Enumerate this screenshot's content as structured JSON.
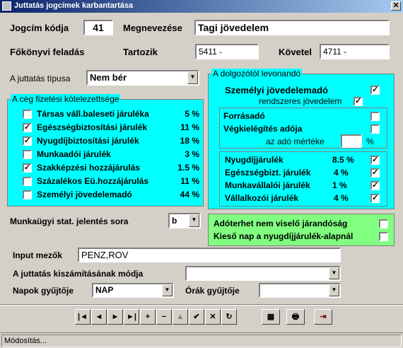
{
  "window": {
    "title": "Juttatás jogcímek karbantartása",
    "close_label": "✕"
  },
  "header": {
    "jogcim_label": "Jogcím kódja",
    "jogcim_value": "41",
    "megnevezes_label": "Megnevezése",
    "megnevezes_value": "Tagi jövedelem",
    "fokonyvi_label": "Főkönyvi feladás",
    "tartozik_label": "Tartozik",
    "tartozik_value": "5411 -",
    "kovetel_label": "Követel",
    "kovetel_value": "4711 -"
  },
  "tipus": {
    "label": "A juttatás típusa",
    "value": "Nem bér"
  },
  "ceg": {
    "title": "A cég fizetési kötelezettsége",
    "items": [
      {
        "label": "Társas váll.baleseti járuléka",
        "pct": "5 %",
        "checked": false
      },
      {
        "label": "Egészségbiztosítási járulék",
        "pct": "11 %",
        "checked": true
      },
      {
        "label": "Nyugdíjbiztosítási járulék",
        "pct": "18 %",
        "checked": true
      },
      {
        "label": "Munkaadói járulék",
        "pct": "3 %",
        "checked": false
      },
      {
        "label": "Szakképzési hozzájárulás",
        "pct": "1.5 %",
        "checked": true
      },
      {
        "label": "Százalékos Eü.hozzájárulás",
        "pct": "11 %",
        "checked": false
      },
      {
        "label": "Személyi jövedelemadó",
        "pct": "44 %",
        "checked": false
      }
    ]
  },
  "levonando": {
    "title": "A dolgozótól levonandó",
    "szja_label": "Személyi jövedelemadó",
    "szja_checked": true,
    "rendszeres_label": "rendszeres jövedelem",
    "rendszeres_checked": true,
    "forrasado_label": "Forrásadó",
    "forrasado_checked": false,
    "vegkielegites_label": "Végkielégítés adója",
    "vegkielegites_checked": false,
    "ado_mertek_label": "az adó mértéke",
    "ado_mertek_value": "",
    "ado_mertek_unit": "%",
    "items": [
      {
        "label": "Nyugdíjjárulék",
        "pct": "8.5 %",
        "checked": true
      },
      {
        "label": "Egészségbizt. járulék",
        "pct": "4 %",
        "checked": true
      },
      {
        "label": "Munkavállalói járulék",
        "pct": "1 %",
        "checked": true
      },
      {
        "label": "Vállalkozói járulék",
        "pct": "4 %",
        "checked": true
      }
    ]
  },
  "green": {
    "adoterhet_label": "Adóterhet nem viselő járandóság",
    "adoterhet_checked": false,
    "kieso_label": "Kieső nap a nyugdíjjárulék-alapnál",
    "kieso_checked": false
  },
  "munkaugyi": {
    "label": "Munkaügyi stat. jelentés sora",
    "value": "b"
  },
  "input_mezok": {
    "label": "Input mezők",
    "value": "PENZ,ROV"
  },
  "kiszamitas": {
    "label": "A juttatás kiszámításának módja",
    "value": ""
  },
  "napok": {
    "label": "Napok gyűjtője",
    "value": "NAP"
  },
  "orak": {
    "label": "Órák gyűjtője",
    "value": ""
  },
  "toolbar": {
    "first": "|◄",
    "prev": "◄",
    "next": "►",
    "last": "►|",
    "add": "+",
    "delete": "−",
    "edit": "▲",
    "confirm": "✔",
    "cancel": "✕",
    "refresh": "↻",
    "grid": "▦",
    "print": "🖶",
    "exit": "⇥"
  },
  "status": {
    "text": "Módosítás..."
  },
  "colors": {
    "cyan": "#00ffff",
    "green": "#80ff80",
    "title_start": "#0a246a",
    "title_end": "#a6caf0"
  }
}
